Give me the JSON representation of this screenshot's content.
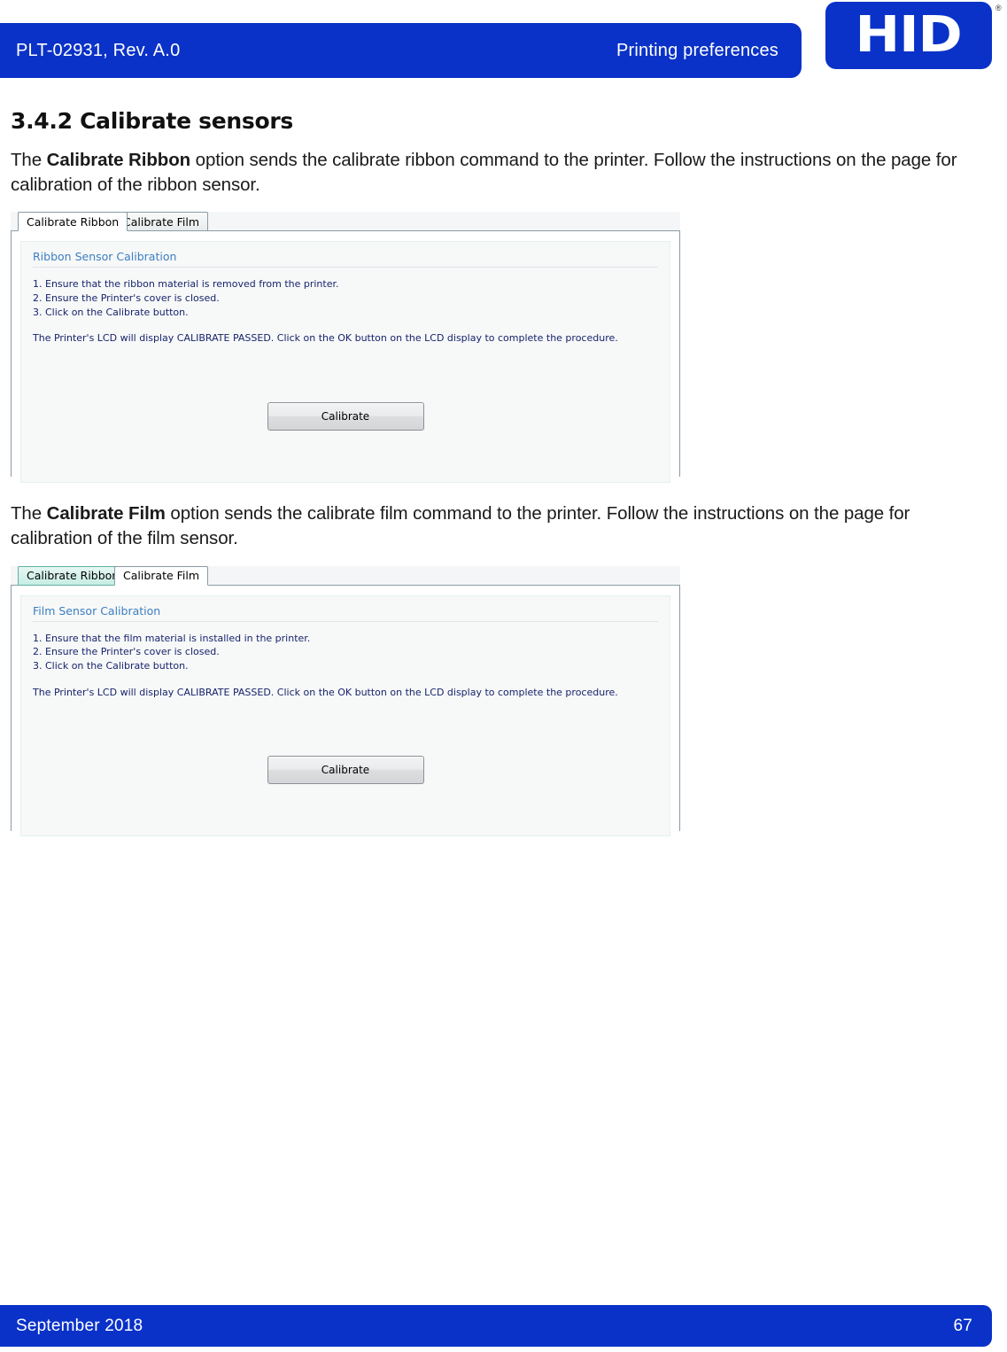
{
  "header": {
    "doc_number": "PLT-02931, Rev. A.0",
    "section_title": "Printing preferences",
    "logo_text": "HID",
    "logo_trademark": "®",
    "bar_color": "#0A32C8"
  },
  "section": {
    "heading": "3.4.2 Calibrate sensors",
    "paragraph_ribbon_prefix": "The ",
    "paragraph_ribbon_bold": "Calibrate Ribbon",
    "paragraph_ribbon_suffix": " option sends the calibrate ribbon command to the printer. Follow the instructions on the page for calibration of the ribbon sensor.",
    "paragraph_film_prefix": "The ",
    "paragraph_film_bold": "Calibrate Film",
    "paragraph_film_suffix": " option sends the calibrate film command to the printer. Follow the instructions on the page for calibration of the film sensor."
  },
  "dialog_ribbon": {
    "tabs": [
      {
        "label": "Calibrate Ribbon",
        "state": "active"
      },
      {
        "label": "Calibrate Film",
        "state": "inactive"
      }
    ],
    "group_title": "Ribbon Sensor Calibration",
    "steps": [
      "1. Ensure that the ribbon material is removed from the printer.",
      "2. Ensure the Printer's cover is closed.",
      "3. Click on the Calibrate button."
    ],
    "note": "The Printer's LCD will display CALIBRATE PASSED.  Click on the OK button on the LCD display to complete the procedure.",
    "button_label": "Calibrate"
  },
  "dialog_film": {
    "tabs": [
      {
        "label": "Calibrate Ribbon",
        "state": "hover"
      },
      {
        "label": "Calibrate Film",
        "state": "active"
      }
    ],
    "group_title": "Film Sensor Calibration",
    "steps": [
      "1. Ensure that the film material is installed in the printer.",
      "2. Ensure the Printer's cover is closed.",
      "3. Click on the Calibrate button."
    ],
    "note": "The Printer's LCD will display CALIBRATE PASSED.  Click on the OK button on the LCD display to complete the procedure.",
    "button_label": "Calibrate"
  },
  "footer": {
    "date": "September 2018",
    "page_number": "67"
  }
}
